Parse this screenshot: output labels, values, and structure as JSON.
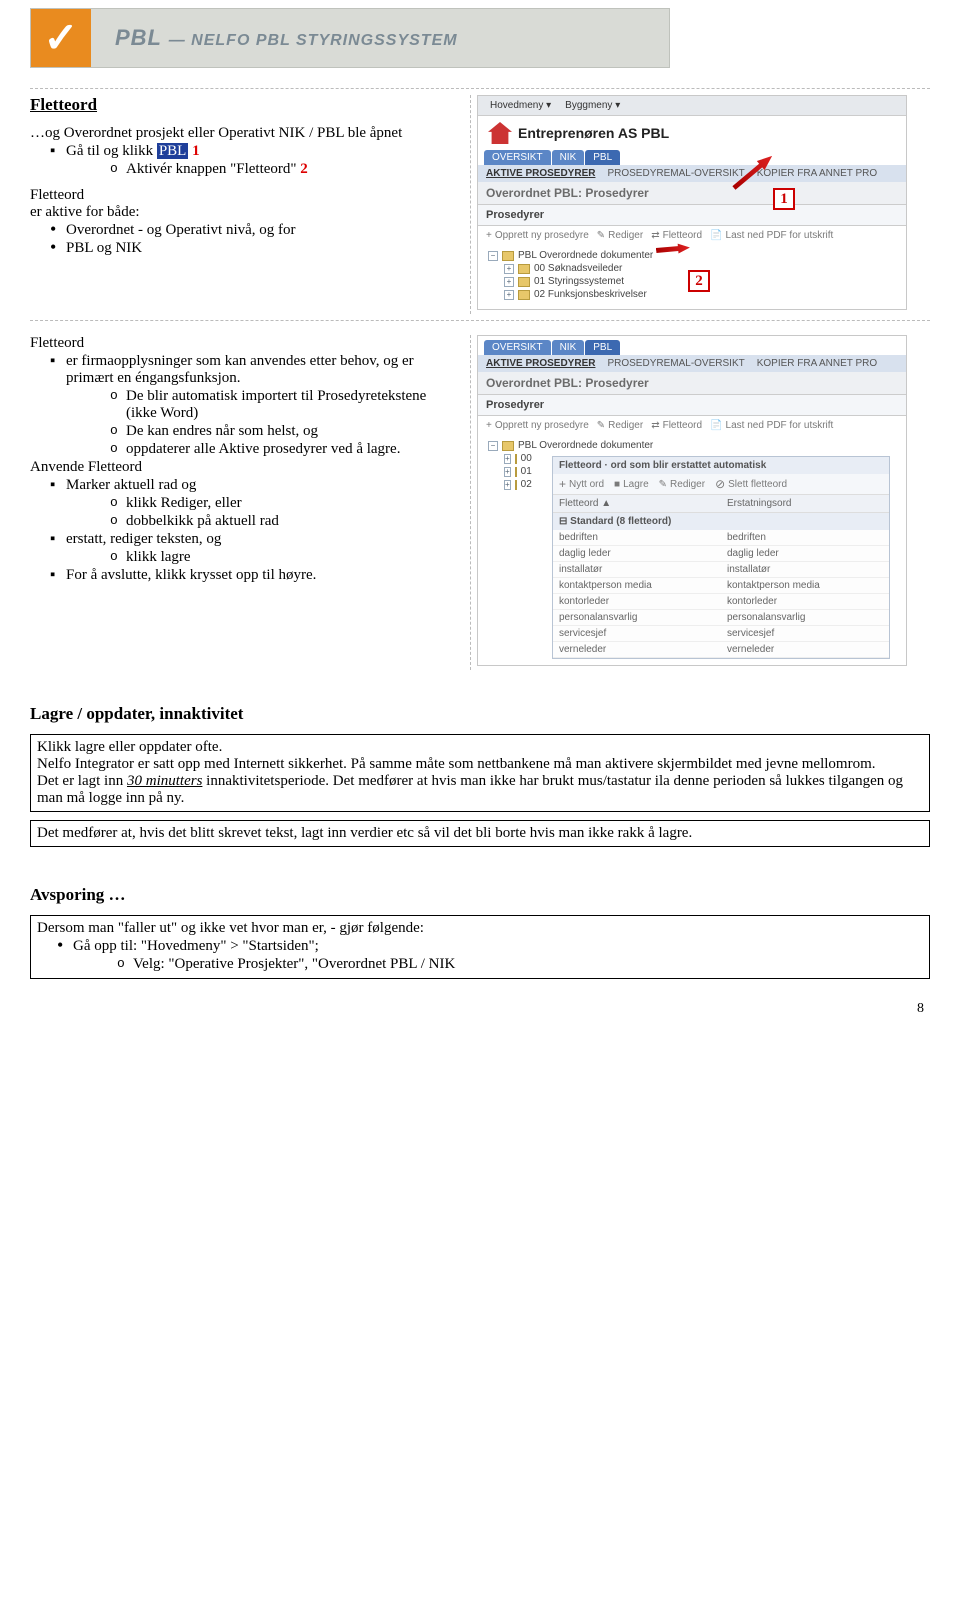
{
  "banner": {
    "logo_glyph": "✓",
    "brand": "PBL",
    "sub": "— Nelfo pbl styringssystem"
  },
  "h_fletteord": "Fletteord",
  "intro_ellipsis": "…og Overordnet prosjekt eller Operativt NIK / PBL ble åpnet",
  "intro_bullets": [
    "Gå til og klikk "
  ],
  "pbl_mark": "PBL",
  "num1": " 1",
  "intro_sub": "Aktivér knappen \"Fletteord\" ",
  "num2": "2",
  "fl_both": "er aktive for både:",
  "fl_dot1": "Overordnet - og Operativt nivå, og for",
  "fl_dot2": "PBL og NIK",
  "ss1": {
    "menu": [
      "Hovedmeny ▾",
      "Byggmeny ▾"
    ],
    "title": "Entreprenøren AS PBL",
    "tabs": [
      "Oversikt",
      "NIK",
      "PBL"
    ],
    "subtabs": [
      "Aktive prosedyrer",
      "Prosedyremal-oversikt",
      "Kopier fra annet pro"
    ],
    "heading": "Overordnet PBL: Prosedyrer",
    "sec": "Prosedyrer",
    "tools": [
      {
        "ic": "+",
        "t": "Opprett ny prosedyre"
      },
      {
        "ic": "✎",
        "t": "Rediger"
      },
      {
        "ic": "⇄",
        "t": "Fletteord"
      },
      {
        "ic": "PDF",
        "t": "Last ned PDF for utskrift"
      }
    ],
    "tree": [
      "PBL Overordnede dokumenter",
      "00 Søknadsveileder",
      "01 Styringssystemet",
      "02 Funksjonsbeskrivelser"
    ],
    "m1": "1",
    "m2": "2"
  },
  "fl3": {
    "p1": "er firmaopplysninger som kan anvendes etter behov, og er primært en éngangsfunksjon.",
    "o1": "De blir automatisk importert til Prosedyretekstene (ikke Word)",
    "o2": "De kan endres når som helst, og",
    "o3": "oppdaterer alle Aktive prosedyrer ved å lagre."
  },
  "anv_head": "Anvende Fletteord",
  "anv_b1": "Marker aktuell rad og",
  "anv_o1": "klikk Rediger, eller",
  "anv_o2": "dobbelkikk på aktuell rad",
  "anv_b2": "erstatt, rediger teksten, og",
  "anv_o3": "klikk lagre",
  "anv_b3": "For å avslutte, klikk krysset opp til høyre.",
  "ss2": {
    "popup_title": "Fletteord · ord som blir erstattet automatisk",
    "tools": [
      {
        "ic": "+",
        "t": "Nytt ord"
      },
      {
        "ic": "■",
        "t": "Lagre"
      },
      {
        "ic": "✎",
        "t": "Rediger"
      },
      {
        "ic": "⊘",
        "t": "Slett fletteord"
      }
    ],
    "cols": [
      "Fletteord ▲",
      "Erstatningsord"
    ],
    "section": "Standard (8 fletteord)",
    "rows": [
      [
        "bedriften",
        "bedriften"
      ],
      [
        "daglig leder",
        "daglig leder"
      ],
      [
        "installatør",
        "installatør"
      ],
      [
        "kontaktperson media",
        "kontaktperson media"
      ],
      [
        "kontorleder",
        "kontorleder"
      ],
      [
        "personalansvarlig",
        "personalansvarlig"
      ],
      [
        "servicesjef",
        "servicesjef"
      ],
      [
        "verneleder",
        "verneleder"
      ]
    ],
    "tree": [
      "PBL Overordnede dokumenter",
      "00",
      "01",
      "02"
    ]
  },
  "lagre_h": "Lagre / oppdater, innaktivitet",
  "lagre1": "Klikk lagre eller oppdater ofte.",
  "lagre2": "Nelfo Integrator er satt opp med Internett sikkerhet. På samme måte som nettbankene må man aktivere skjermbildet med jevne mellomrom.",
  "lagre3a": "Det er lagt inn ",
  "lagre3b": "30 minutters",
  "lagre3c": " innaktivitetsperiode. Det medfører at hvis man ikke har brukt mus/tastatur ila denne perioden så lukkes tilgangen og man må logge inn på ny.",
  "lagre4": "Det medfører at, hvis det blitt skrevet tekst, lagt inn verdier etc så vil det bli borte hvis man ikke rakk å lagre.",
  "avs_h": "Avsporing …",
  "avs_p": "Dersom man \"faller ut\" og ikke vet hvor man er, - gjør følgende:",
  "avs_d1": "Gå opp til: \"Hovedmeny\" > \"Startsiden\";",
  "avs_o1": "Velg: \"Operative Prosjekter\", \"Overordnet PBL / NIK",
  "page": "8"
}
